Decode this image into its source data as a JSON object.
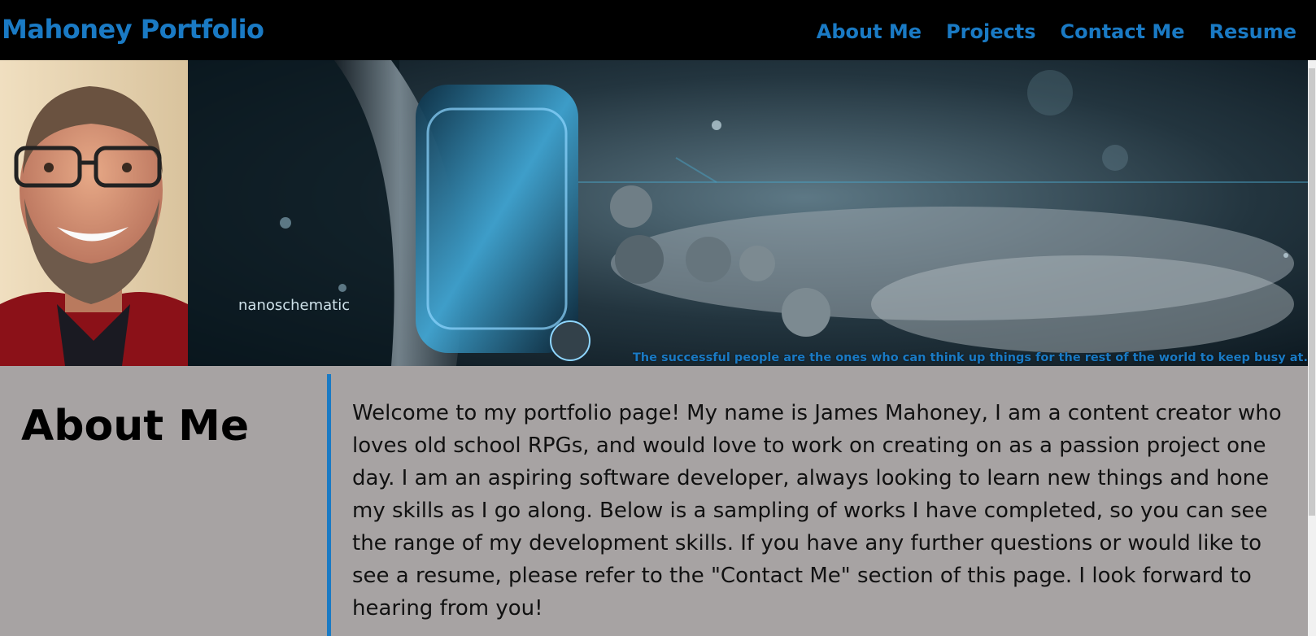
{
  "header": {
    "brand": "Mahoney Portfolio",
    "nav": [
      {
        "label": "About Me"
      },
      {
        "label": "Projects"
      },
      {
        "label": "Contact Me"
      },
      {
        "label": "Resume"
      }
    ]
  },
  "hero": {
    "banner_text": "nanoschematic",
    "quote": "The successful people are the ones who can think up things for the rest of the world to keep busy at."
  },
  "about": {
    "title": "About Me",
    "text": "Welcome to my portfolio page! My name is James Mahoney, I am a content creator who loves old school RPGs, and would love to work on creating on as a passion project one day. I am an aspiring software developer, always looking to learn new things and hone my skills as I go along. Below is a sampling of works I have completed, so you can see the range of my development skills. If you have any further questions or would like to see a resume, please refer to the \"Contact Me\" section of this page. I look forward to hearing from you!"
  },
  "colors": {
    "accent": "#1a7ac4",
    "header_bg": "#000000",
    "about_bg": "#a7a3a3",
    "text": "#111111"
  }
}
